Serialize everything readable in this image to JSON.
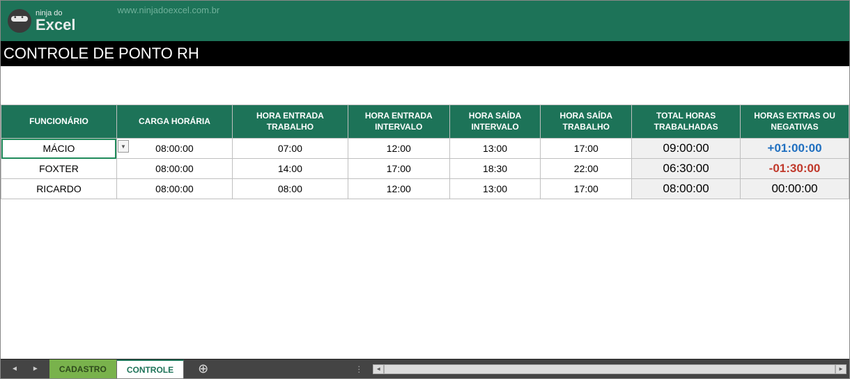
{
  "header": {
    "logo_small": "ninja do",
    "logo_big": "Excel",
    "site_url": "www.ninjadoexcel.com.br"
  },
  "title": "CONTROLE DE PONTO RH",
  "table": {
    "headers": {
      "funcionario": "FUNCIONÁRIO",
      "carga": "CARGA HORÁRIA",
      "entrada_trab": "HORA ENTRADA TRABALHO",
      "entrada_int": "HORA ENTRADA INTERVALO",
      "saida_int": "HORA SAÍDA INTERVALO",
      "saida_trab": "HORA SAÍDA TRABALHO",
      "total": "TOTAL HORAS TRABALHADAS",
      "extras": "HORAS EXTRAS OU NEGATIVAS"
    },
    "rows": [
      {
        "funcionario": "MÁCIO",
        "carga": "08:00:00",
        "entrada_trab": "07:00",
        "entrada_int": "12:00",
        "saida_int": "13:00",
        "saida_trab": "17:00",
        "total": "09:00:00",
        "extras": "+01:00:00",
        "extras_class": "pos"
      },
      {
        "funcionario": "FOXTER",
        "carga": "08:00:00",
        "entrada_trab": "14:00",
        "entrada_int": "17:00",
        "saida_int": "18:30",
        "saida_trab": "22:00",
        "total": "06:30:00",
        "extras": "-01:30:00",
        "extras_class": "neg"
      },
      {
        "funcionario": "RICARDO",
        "carga": "08:00:00",
        "entrada_trab": "08:00",
        "entrada_int": "12:00",
        "saida_int": "13:00",
        "saida_trab": "17:00",
        "total": "08:00:00",
        "extras": "00:00:00",
        "extras_class": ""
      }
    ]
  },
  "tabs": {
    "cadastro": "CADASTRO",
    "controle": "CONTROLE"
  }
}
